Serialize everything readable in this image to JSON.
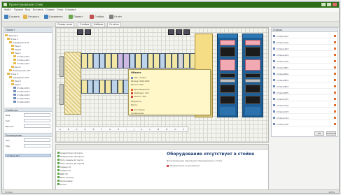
{
  "window": {
    "title": "Проектирование стоек"
  },
  "menu": [
    "Файл",
    "Правка",
    "Вид",
    "Вставка",
    "Сервис",
    "Окно",
    "Справка"
  ],
  "toolbar": [
    {
      "label": "Создать",
      "color": "#3f7fc0"
    },
    {
      "label": "Открыть",
      "color": "#e2b54a"
    },
    {
      "label": "Сохранить",
      "color": "#3f7fc0"
    },
    {
      "label": "Проект",
      "color": "#6aa84f"
    },
    {
      "label": "Стойка",
      "color": "#c0504d"
    },
    {
      "label": "Отчёт",
      "color": "#7f7f7f"
    }
  ],
  "tabs": [
    "Схема зала",
    "Стойки",
    "Кабели",
    "Отчёты"
  ],
  "left_panel": {
    "header": "Проект",
    "tree": [
      "Здание 1",
      "Этаж 1",
      "Серверная 101",
      "Ряд A",
      "Ряд B",
      "Ряд C",
      "Стойка A01",
      "Стойка A02",
      "Стойка A03",
      "Кросс",
      "Помещение 102",
      "Этаж 2",
      "Серверная 201",
      "Ряд D",
      "Ряд E",
      "Стойка D01",
      "Стойка D02",
      "Стойка D03",
      "Стойка D04",
      "Стойка D05"
    ],
    "section1": "Свойства",
    "rows1": [
      "Имя",
      "Тип",
      "Высота"
    ],
    "section2": "Размещение",
    "rows2": [
      "Зал",
      "Ряд"
    ],
    "selected": "Стойка A01"
  },
  "ruler": [
    "A",
    "B",
    "C",
    "D",
    "E",
    "F",
    "G",
    "H",
    "I",
    "J",
    "K",
    "L",
    "M",
    "N",
    "O",
    "P"
  ],
  "popup": {
    "title": "Объект",
    "lines": [
      "Тип: стойка",
      "Размер: 600x1000",
      "Высота: 42U",
      "Производитель",
      "Свободно: 12U",
      "Занято: 30U",
      "Мощность",
      "Масса",
      "Состояние",
      "Примечание"
    ]
  },
  "bottom": {
    "title": "Оборудование отсутствует в стойке",
    "subtitle": "Для размещения перетащите оборудование в стойку",
    "note": "Оборудование не размещено",
    "list": [
      "Коммутатор 24 порта",
      "Коммутатор 48 портов",
      "Патч-панель 24 порта",
      "Патч-панель 48 портов",
      "Сервер 1U",
      "Сервер 2U",
      "ИБП 3U",
      "Блок розеток",
      "Органайзер",
      "Полка"
    ]
  },
  "right_panel": {
    "header": "Список",
    "items": [
      "Стойка A01",
      "Стойка A02",
      "Стойка A03",
      "Стойка A04",
      "Стойка A05",
      "Стойка B01",
      "Стойка B02",
      "Стойка B03",
      "Стойка B04",
      "Стойка B05",
      "Стойка C01",
      "Стойка C02",
      "Стойка C03",
      "Стойка C04",
      "Стойка C05"
    ],
    "buttons": [
      "OK",
      "Отмена"
    ]
  },
  "status": {
    "left": "Готово",
    "right": "100%"
  }
}
